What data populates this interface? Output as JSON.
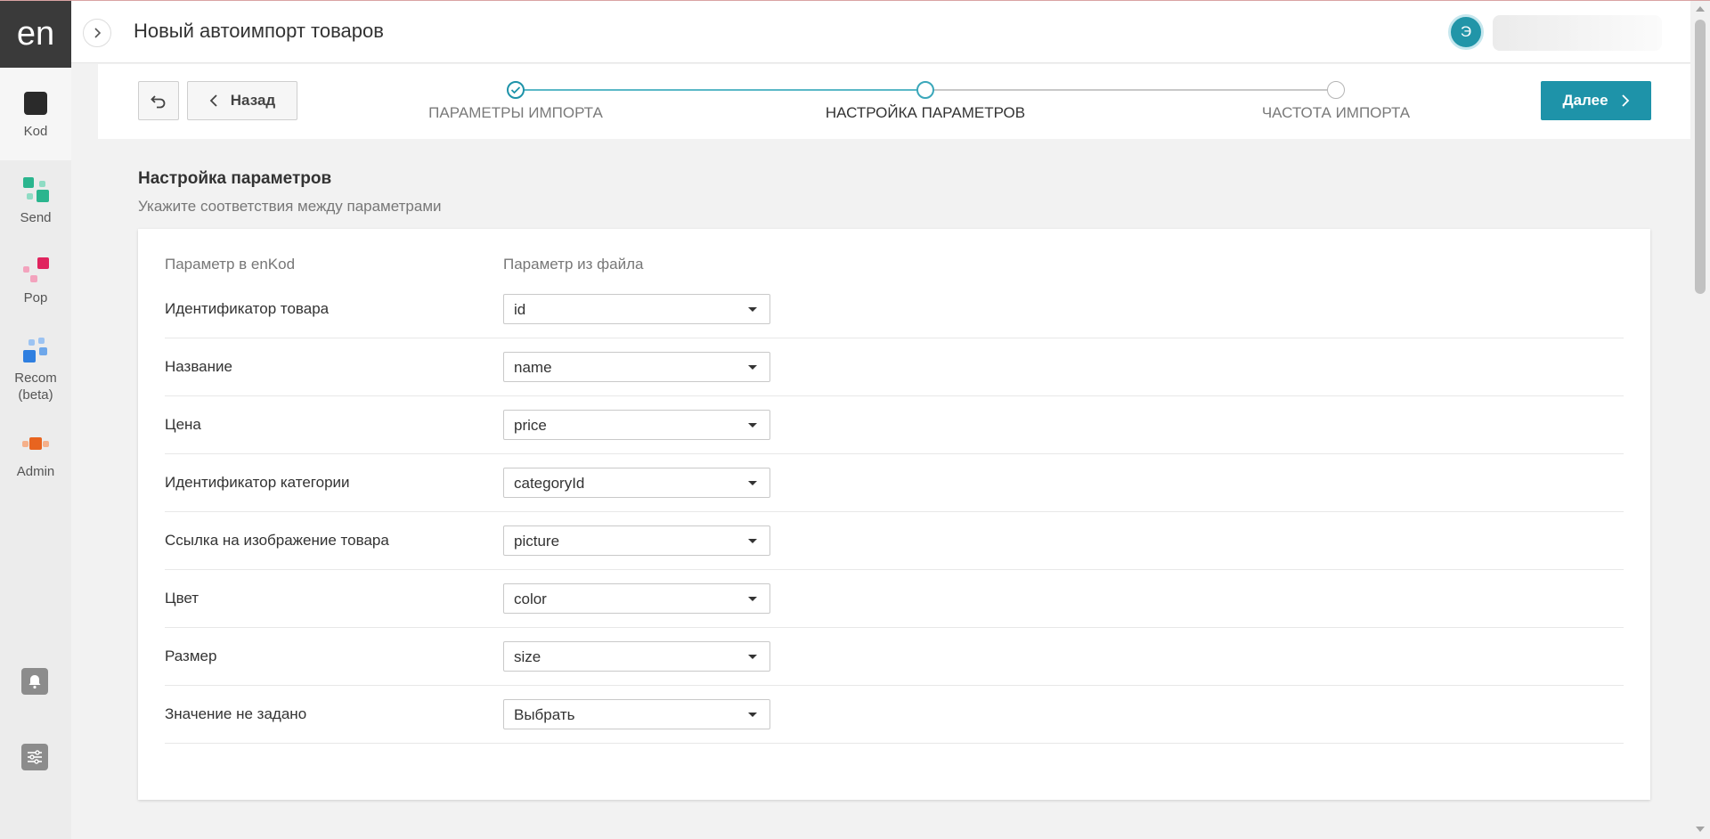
{
  "sidebar": {
    "logo": "en",
    "items": [
      {
        "label": "Kod",
        "icon": "kod-icon"
      },
      {
        "label": "Send",
        "icon": "send-icon"
      },
      {
        "label": "Pop",
        "icon": "pop-icon"
      },
      {
        "label": "Recom\n(beta)",
        "icon": "recom-icon"
      },
      {
        "label": "Admin",
        "icon": "admin-icon"
      }
    ],
    "bottom_icons": [
      "bell-icon",
      "sliders-icon"
    ]
  },
  "header": {
    "title": "Новый автоимпорт товаров",
    "avatar_initial": "Э"
  },
  "toolbar": {
    "back_label": "Назад",
    "next_label": "Далее"
  },
  "steps": [
    {
      "label": "ПАРАМЕТРЫ ИМПОРТА",
      "state": "done"
    },
    {
      "label": "НАСТРОЙКА ПАРАМЕТРОВ",
      "state": "active"
    },
    {
      "label": "ЧАСТОТА ИМПОРТА",
      "state": "pending"
    }
  ],
  "section": {
    "title": "Настройка параметров",
    "subtitle": "Укажите соответствия между параметрами",
    "col_enkod": "Параметр в enKod",
    "col_file": "Параметр из файла",
    "rows": [
      {
        "label": "Идентификатор товара",
        "value": "id"
      },
      {
        "label": "Название",
        "value": "name"
      },
      {
        "label": "Цена",
        "value": "price"
      },
      {
        "label": "Идентификатор категории",
        "value": "categoryId"
      },
      {
        "label": "Ссылка на изображение товара",
        "value": "picture"
      },
      {
        "label": "Цвет",
        "value": "color"
      },
      {
        "label": "Размер",
        "value": "size"
      },
      {
        "label": "Значение не задано",
        "value": "Выбрать"
      }
    ]
  },
  "colors": {
    "accent": "#1e93a9",
    "step_done": "#1e93a9",
    "step_line_done": "#5bb8c7",
    "step_line_pending": "#c8c8c8",
    "sidebar_bg": "#ececec",
    "logo_bg": "#3a3a3a"
  }
}
